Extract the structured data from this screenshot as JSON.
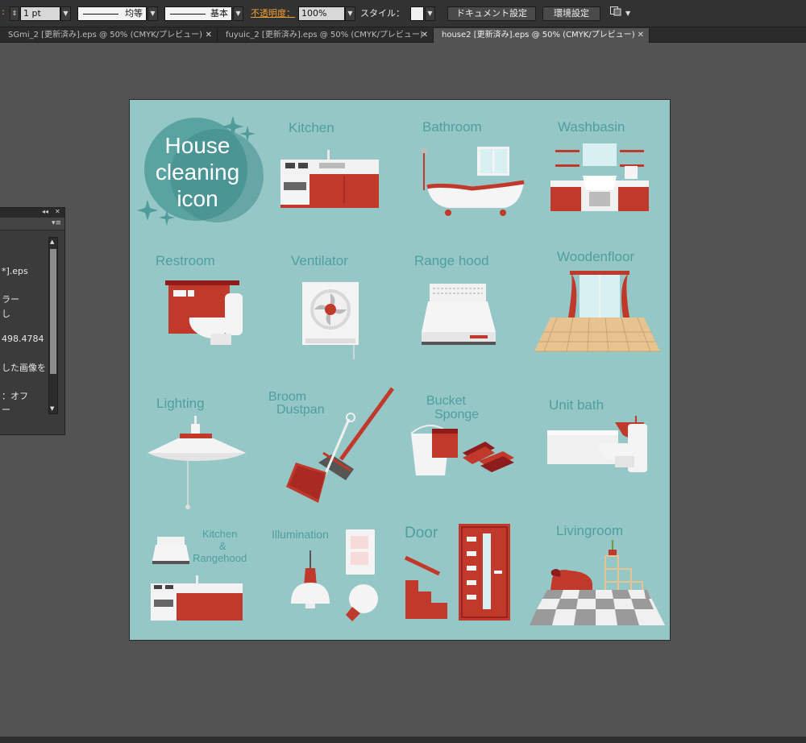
{
  "toolbar": {
    "stroke_weight": "1 pt",
    "profile_label": "均等",
    "brush_label": "基本",
    "opacity_label": "不透明度：",
    "opacity_value": "100%",
    "style_label": "スタイル：",
    "doc_settings_button": "ドキュメント設定",
    "prefs_button": "環境設定",
    "accent_color": "#f0a030"
  },
  "tabs": [
    {
      "label": "SGmi_2 [更新済み].eps @ 50% (CMYK/プレビュー)",
      "active": false
    },
    {
      "label": "fuyuic_2 [更新済み].eps @ 50% (CMYK/プレビュー)",
      "active": false
    },
    {
      "label": "house2 [更新済み].eps @ 50% (CMYK/プレビュー)",
      "active": true
    }
  ],
  "panel": {
    "lines": [
      "*].eps",
      "ラー",
      "し",
      "498.4784",
      "した画像を",
      "：オフ",
      "ー"
    ]
  },
  "artboard": {
    "title_lines": [
      "House",
      "cleaning",
      "icon"
    ],
    "labels": {
      "kitchen": "Kitchen",
      "bathroom": "Bathroom",
      "washbasin": "Washbasin",
      "restroom": "Restroom",
      "ventilator": "Ventilator",
      "rangehood": "Range hood",
      "woodenfloor": "Woodenfloor",
      "lighting": "Lighting",
      "broom": "Broom",
      "dustpan": "Dustpan",
      "bucket": "Bucket",
      "sponge": "Sponge",
      "unitbath": "Unit bath",
      "kr1": "Kitchen",
      "kr2": "&",
      "kr3": "Rangehood",
      "illumination": "Illumination",
      "door": "Door",
      "livingroom": "Livingroom"
    },
    "colors": {
      "background": "#96c7c7",
      "red": "#c0392b",
      "dark_red": "#8e1c1c",
      "label": "#4f9ea0",
      "teal_circle": "#4f9c9a",
      "white": "#f5f5f5",
      "gray": "#d8d8d8"
    }
  }
}
